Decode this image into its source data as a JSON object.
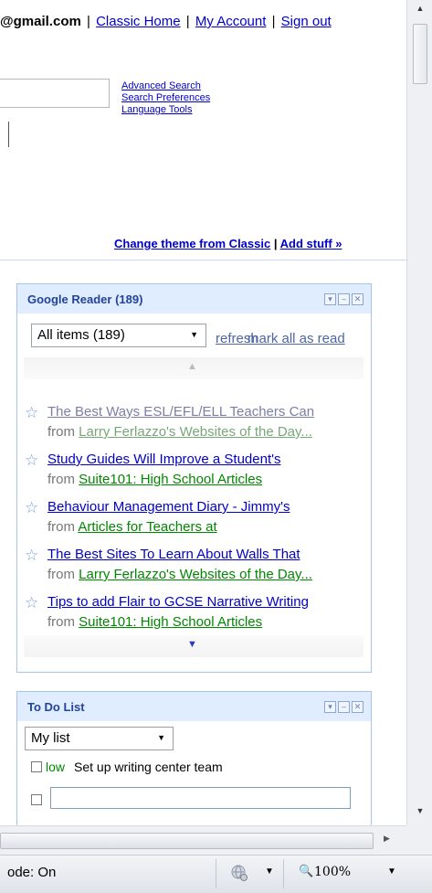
{
  "topbar": {
    "account": "@gmail.com",
    "links": [
      "Classic Home",
      "My Account",
      "Sign out"
    ]
  },
  "search": {
    "links": [
      "Advanced Search",
      "Search Preferences",
      "Language Tools"
    ]
  },
  "theme": {
    "change_theme": "Change theme from Classic",
    "add_stuff": "Add stuff »"
  },
  "reader": {
    "title": "Google Reader (189)",
    "filter": "All items (189)",
    "refresh": "refresh",
    "mark_all": "mark all as read",
    "items": [
      {
        "title": "The Best Ways ESL/EFL/ELL Teachers Can",
        "from": "from",
        "source": "Larry Ferlazzo's Websites of the Day...",
        "read": true
      },
      {
        "title": "Study Guides Will Improve a Student's",
        "from": "from",
        "source": "Suite101: High School Articles",
        "read": false
      },
      {
        "title": "Behaviour Management Diary - Jimmy's",
        "from": "from",
        "source": "Articles for Teachers at",
        "read": false
      },
      {
        "title": "The Best Sites To Learn About Walls That",
        "from": "from",
        "source": "Larry Ferlazzo's Websites of the Day...",
        "read": false
      },
      {
        "title": "Tips to add Flair to GCSE Narrative Writing",
        "from": "from",
        "source": "Suite101: High School Articles",
        "read": false
      }
    ]
  },
  "todo": {
    "title": "To Do List",
    "list_select": "My list",
    "tasks": [
      {
        "priority": "low",
        "text": "Set up writing center team"
      }
    ]
  },
  "statusbar": {
    "mode": "ode: On",
    "zoom": "100%"
  },
  "colors": {
    "link": "#0000cc",
    "gadget_header": "#e0ecff",
    "gadget_title": "#224499",
    "source_link": "#008800"
  }
}
